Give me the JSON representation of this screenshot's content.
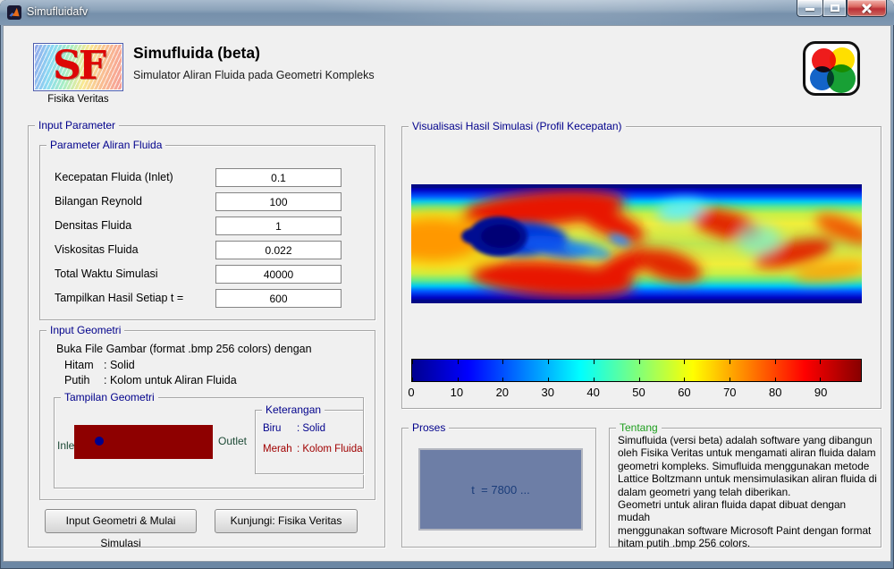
{
  "window": {
    "title": "Simufluidafv",
    "icons": {
      "app": "matlab-logo",
      "minimize": "horizontal-bar",
      "maximize": "square-outline",
      "close": "x-cross"
    }
  },
  "header": {
    "logo_text": "SF",
    "logo_caption": "Fisika Veritas",
    "title": "Simufluida (beta)",
    "subtitle": "Simulator Aliran Fluida pada Geometri Kompleks"
  },
  "input_parameter": {
    "title": "Input Parameter",
    "parameter_aliran": {
      "title": "Parameter Aliran Fluida",
      "fields": [
        {
          "label": "Kecepatan Fluida (Inlet)",
          "value": "0.1"
        },
        {
          "label": "Bilangan Reynold",
          "value": "100"
        },
        {
          "label": "Densitas Fluida",
          "value": "1"
        },
        {
          "label": "Viskositas Fluida",
          "value": "0.022"
        },
        {
          "label": "Total Waktu Simulasi",
          "value": "40000"
        },
        {
          "label": "Tampilkan Hasil Setiap t =",
          "value": "600"
        }
      ]
    },
    "input_geometri": {
      "title": "Input Geometri",
      "instruction": "Buka File Gambar (format .bmp 256 colors) dengan",
      "legend_black_key": "Hitam",
      "legend_black_val": ": Solid",
      "legend_white_key": "Putih",
      "legend_white_val": ": Kolom untuk Aliran Fluida",
      "tampilan_geometri": {
        "title": "Tampilan Geometri",
        "inlet_label": "Inlet",
        "outlet_label": "Outlet"
      },
      "keterangan": {
        "title": "Keterangan",
        "biru_key": "Biru",
        "biru_val": ": Solid",
        "merah_key": "Merah",
        "merah_val": ": Kolom Fluida"
      }
    },
    "buttons": {
      "simulate": "Input Geometri & Mulai Simulasi",
      "visit": "Kunjungi: Fisika Veritas"
    }
  },
  "visualization": {
    "title": "Visualisasi Hasil Simulasi (Profil Kecepatan)"
  },
  "proses": {
    "title": "Proses",
    "status": "t  = 7800 ..."
  },
  "tentang": {
    "title": "Tentang",
    "body": "Simufluida (versi beta) adalah software yang dibangun\noleh Fisika Veritas untuk mengamati aliran fluida dalam\ngeometri kompleks. Simufluida menggunakan metode\nLattice Boltzmann untuk mensimulasikan aliran fluida di\ndalam geometri yang telah diberikan.\nGeometri untuk aliran fluida dapat dibuat dengan mudah\nmenggunakan software Microsoft Paint dengan format\nhitam putih .bmp 256 colors."
  },
  "chart_data": {
    "type": "heatmap",
    "title": "Visualisasi Hasil Simulasi (Profil Kecepatan)",
    "description": "Velocity-magnitude field of 2D flow past an obstacle (von Karman vortex street), jet colormap: dark blue = slow (obstacle, walls, wake), red = fast shear layers alternating downstream.",
    "colormap": "jet",
    "colorbar": {
      "orientation": "horizontal",
      "tick_labels": [
        "0",
        "10",
        "20",
        "30",
        "40",
        "50",
        "60",
        "70",
        "80",
        "90"
      ],
      "range": [
        0,
        99
      ]
    }
  },
  "colors": {
    "panel_title": "#00008b",
    "tentang_title": "#1e9e1e",
    "geometry_solid_red": "#8e0000",
    "geometry_dot_blue": "#00008b",
    "inlet_outlet_text": "#1d4a36",
    "proses_box_fill": "#6d7ea6",
    "proses_text": "#1b3d7a",
    "keterangan_biru": "#00008b",
    "keterangan_merah": "#a00000",
    "close_button_red": "#bc3036",
    "titlebar_blue": "#7a93ae"
  }
}
